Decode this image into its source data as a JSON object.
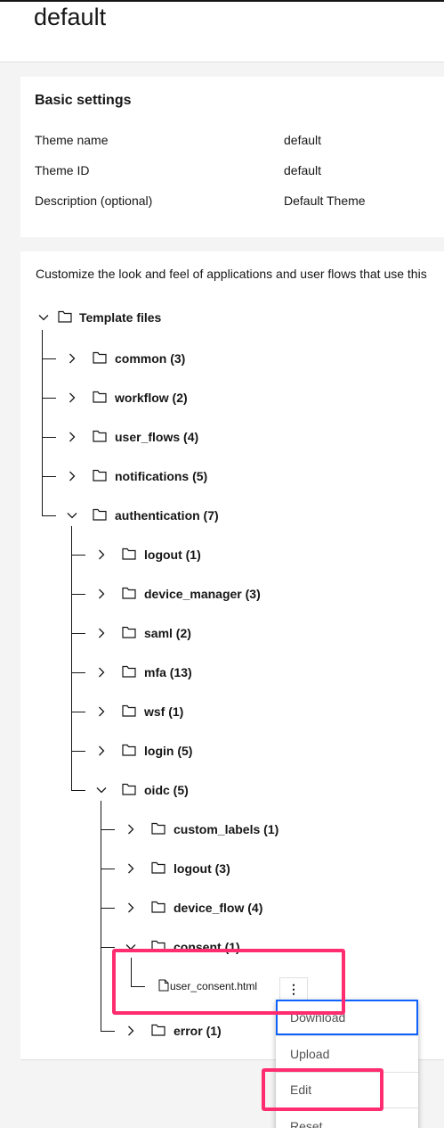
{
  "page": {
    "title": "default"
  },
  "basic_settings": {
    "title": "Basic settings",
    "fields": [
      {
        "label": "Theme name",
        "value": "default"
      },
      {
        "label": "Theme ID",
        "value": "default"
      },
      {
        "label": "Description (optional)",
        "value": "Default Theme"
      }
    ]
  },
  "templates": {
    "intro": "Customize the look and feel of applications and user flows that use this",
    "root_label": "Template files",
    "level1": [
      {
        "label": "common (3)",
        "expanded": false
      },
      {
        "label": "workflow (2)",
        "expanded": false
      },
      {
        "label": "user_flows (4)",
        "expanded": false
      },
      {
        "label": "notifications (5)",
        "expanded": false
      },
      {
        "label": "authentication (7)",
        "expanded": true
      }
    ],
    "authentication_children": [
      {
        "label": "logout (1)",
        "expanded": false
      },
      {
        "label": "device_manager (3)",
        "expanded": false
      },
      {
        "label": "saml (2)",
        "expanded": false
      },
      {
        "label": "mfa (13)",
        "expanded": false
      },
      {
        "label": "wsf (1)",
        "expanded": false
      },
      {
        "label": "login (5)",
        "expanded": false
      },
      {
        "label": "oidc (5)",
        "expanded": true
      }
    ],
    "oidc_children": [
      {
        "label": "custom_labels (1)",
        "expanded": false
      },
      {
        "label": "logout (3)",
        "expanded": false
      },
      {
        "label": "device_flow (4)",
        "expanded": false
      },
      {
        "label": "consent (1)",
        "expanded": true
      },
      {
        "label": "error (1)",
        "expanded": false
      }
    ],
    "consent_file": "user_consent.html"
  },
  "overflow_menu": {
    "kebab_icon": "⋮",
    "items": [
      "Download",
      "Upload",
      "Edit",
      "Reset"
    ]
  },
  "colors": {
    "focus": "#0f62fe",
    "highlight": "#ff2d6f"
  }
}
